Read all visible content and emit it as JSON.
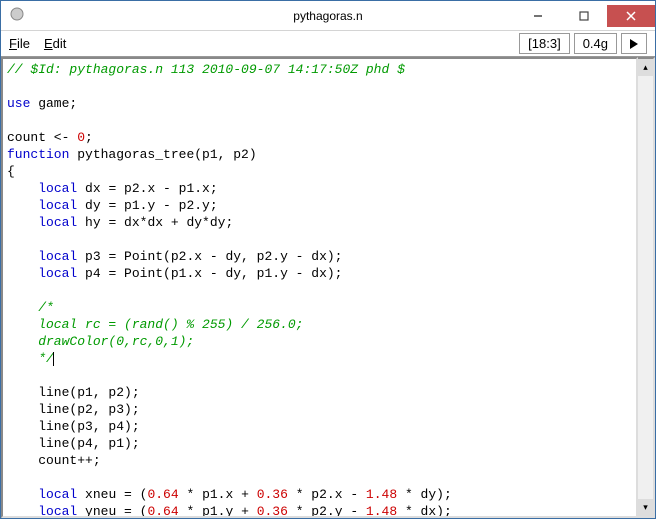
{
  "window": {
    "title": "pythagoras.n"
  },
  "menu": {
    "file": "File",
    "edit": "Edit"
  },
  "status": {
    "cursor": "[18:3]",
    "mem": "0.4g"
  },
  "code": {
    "l1_comment": "// $Id: pythagoras.n 113 2010-09-07 14:17:50Z phd $",
    "l3_use": "use",
    "l3_rest": " game;",
    "l5_count": "count <- ",
    "l5_zero": "0",
    "l5_semi": ";",
    "l6_func": "function",
    "l6_rest": " pythagoras_tree(p1, p2)",
    "l7": "{",
    "l8_local": "local",
    "l8_rest": " dx = p2.x - p1.x;",
    "l9_local": "local",
    "l9_rest": " dy = p1.y - p2.y;",
    "l10_local": "local",
    "l10_rest": " hy = dx*dx + dy*dy;",
    "l12_local": "local",
    "l12_rest": " p3 = Point(p2.x - dy, p2.y - dx);",
    "l13_local": "local",
    "l13_rest": " p4 = Point(p1.x - dy, p1.y - dx);",
    "l15": "    /*",
    "l16": "    local rc = (rand() % 255) / 256.0;",
    "l17": "    drawColor(0,rc,0,1);",
    "l18": "    */",
    "l20": "    line(p1, p2);",
    "l21": "    line(p2, p3);",
    "l22": "    line(p3, p4);",
    "l23": "    line(p4, p1);",
    "l24": "    count++;",
    "l26_local": "local",
    "l26_a": " xneu = (",
    "l26_n1": "0.64",
    "l26_b": " * p1.x + ",
    "l26_n2": "0.36",
    "l26_c": " * p2.x - ",
    "l26_n3": "1.48",
    "l26_d": " * dy);",
    "l27_local": "local",
    "l27_a": " yneu = (",
    "l27_n1": "0.64",
    "l27_b": " * p1.y + ",
    "l27_n2": "0.36",
    "l27_c": " * p2.y - ",
    "l27_n3": "1.48",
    "l27_d": " * dx);"
  }
}
